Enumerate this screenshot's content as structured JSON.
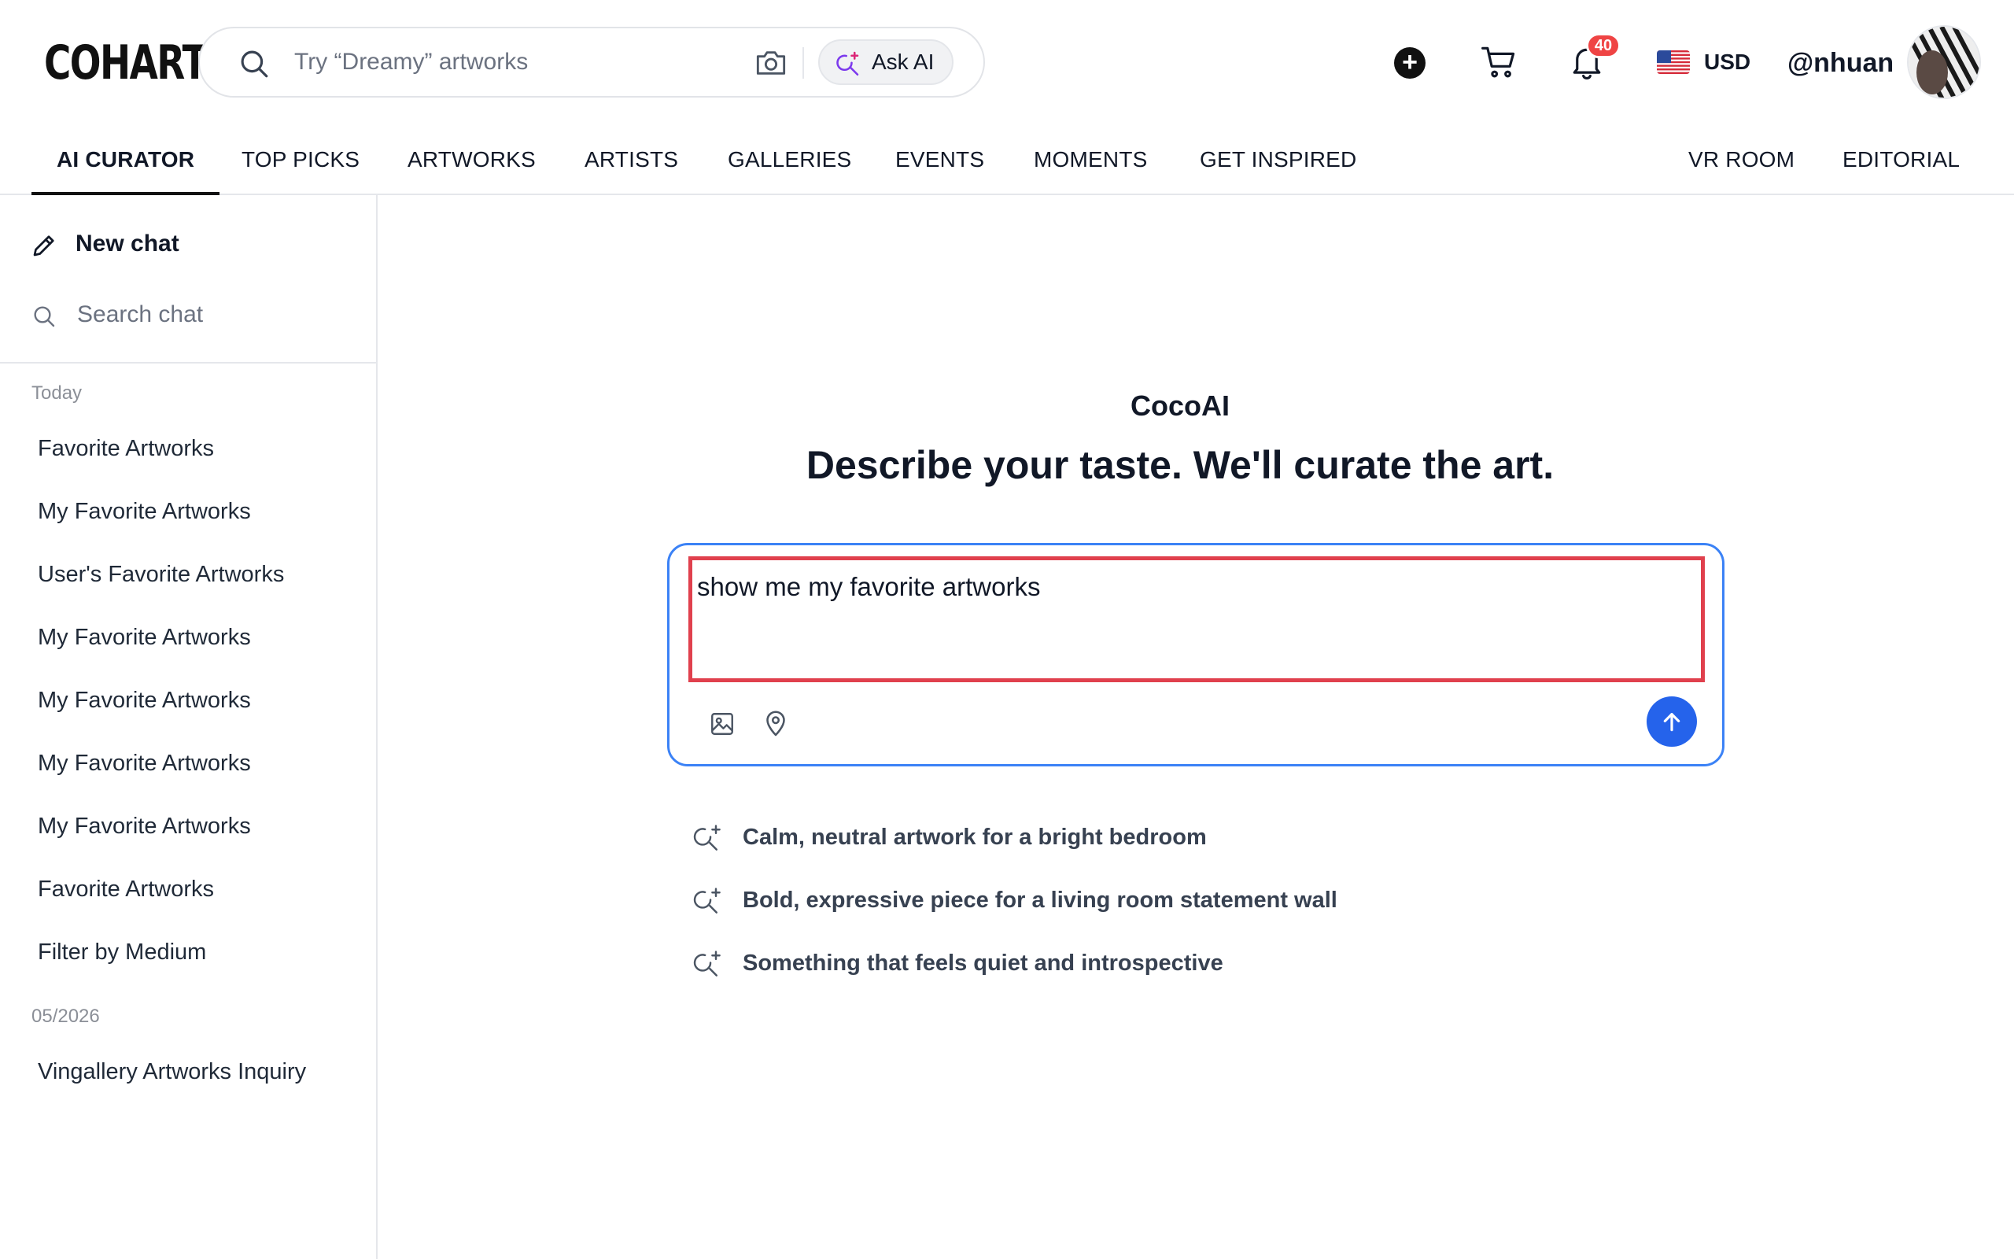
{
  "header": {
    "logo": "COHART",
    "search_placeholder": "Try “Dreamy” artworks",
    "ask_ai_label": "Ask AI",
    "notification_count": "40",
    "currency": "USD",
    "username": "@nhuan"
  },
  "nav": {
    "items": [
      "AI CURATOR",
      "TOP PICKS",
      "ARTWORKS",
      "ARTISTS",
      "GALLERIES",
      "EVENTS",
      "MOMENTS",
      "GET INSPIRED"
    ],
    "right_items": [
      "VR ROOM",
      "EDITORIAL"
    ],
    "active": "AI CURATOR"
  },
  "sidebar": {
    "new_chat": "New chat",
    "search_chat": "Search chat",
    "sections": [
      {
        "title": "Today",
        "items": [
          "Favorite Artworks",
          "My Favorite Artworks",
          "User's Favorite Artworks",
          "My Favorite Artworks",
          "My Favorite Artworks",
          "My Favorite Artworks",
          "My Favorite Artworks",
          "Favorite Artworks",
          "Filter by Medium"
        ]
      },
      {
        "title": "05/2026",
        "items": [
          "Vingallery Artworks Inquiry"
        ]
      }
    ]
  },
  "main": {
    "assistant_name": "CocoAI",
    "headline": "Describe your taste. We'll curate the art.",
    "input_value": "show me my favorite artworks",
    "suggestions": [
      "Calm, neutral artwork for a bright bedroom",
      "Bold, expressive piece for a living room statement wall",
      "Something that feels quiet and introspective"
    ]
  },
  "colors": {
    "accent": "#2563eb",
    "composer_border": "#3b82f6",
    "highlight_box": "#e0404d",
    "badge": "#ef4444"
  }
}
